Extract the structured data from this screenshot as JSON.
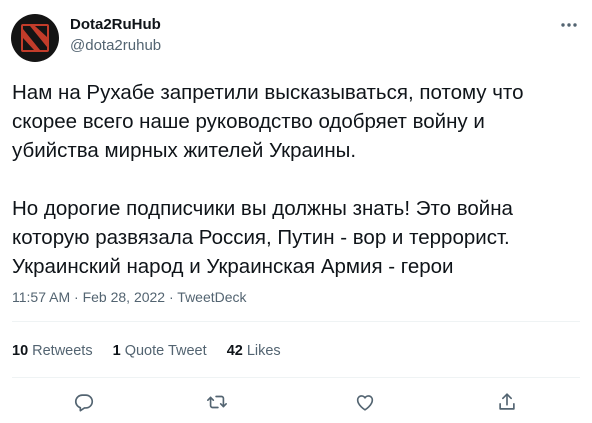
{
  "author": {
    "name": "Dota2RuHub",
    "handle": "@dota2ruhub",
    "avatar_icon": "dota2-logo-icon"
  },
  "tweet": {
    "paragraphs": [
      [
        "Нам на Рухабе запретили высказываться, потому что",
        "скорее всего наше руководство одобряет войну и",
        "убийства мирных жителей Украины."
      ],
      [
        "Но дорогие подписчики вы должны знать! Это война",
        "которую развязала Россия, Путин - вор и террорист.",
        "Украинский народ и Украинская Армия - герои"
      ]
    ]
  },
  "meta": {
    "time": "11:57 AM",
    "separator": "·",
    "date": "Feb 28, 2022",
    "source": "TweetDeck"
  },
  "stats": {
    "retweets_count": "10",
    "retweets_label": "Retweets",
    "quotes_count": "1",
    "quotes_label": "Quote Tweet",
    "likes_count": "42",
    "likes_label": "Likes"
  },
  "icons": {
    "more": "more-icon",
    "reply": "reply-icon",
    "retweet": "retweet-icon",
    "like": "like-icon",
    "share": "share-icon"
  },
  "colors": {
    "text": "#0f1419",
    "secondary": "#536471",
    "divider": "#eff3f4",
    "avatar_bg": "#141414",
    "logo_red": "#c23c2a"
  }
}
